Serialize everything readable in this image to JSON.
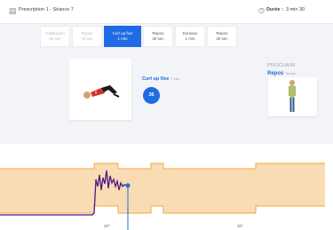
{
  "header": {
    "title": "Prescription 1 - Séance 7",
    "duration_label": "Durée :",
    "duration_value": "3 min 30"
  },
  "steps": [
    {
      "label": "Calibration",
      "value": "30 sec",
      "state": "done"
    },
    {
      "label": "Repos",
      "value": "15 sec",
      "state": "done"
    },
    {
      "label": "Curl up fixe",
      "value": "1 min",
      "state": "active"
    },
    {
      "label": "Repos",
      "value": "30 sec",
      "state": "upcoming"
    },
    {
      "label": "Dorsaux",
      "value": "1 min",
      "state": "upcoming"
    },
    {
      "label": "Repos",
      "value": "30 sec",
      "state": "upcoming"
    }
  ],
  "exercise": {
    "name": "Curl up fixe",
    "duration": "1 min",
    "counter": "36"
  },
  "next": {
    "label": "PROCHAIN",
    "name": "Repos",
    "duration": "30 sec"
  },
  "chart_data": {
    "type": "line",
    "x_ticks": [
      "30\"",
      "30\""
    ],
    "target_band": {
      "low": 0.3,
      "high": 0.7
    },
    "series": [
      {
        "color": "#4b1a86",
        "values": [
          0.26,
          0.27,
          0.26,
          0.27,
          0.26,
          0.27,
          0.3,
          0.5,
          0.6,
          0.45,
          0.7,
          0.55,
          0.68,
          0.5,
          0.65,
          0.45,
          0.6,
          0.55,
          0.4,
          0.5
        ]
      }
    ],
    "cursor_value": 0.52,
    "colors": {
      "band": "#f8d3a0",
      "band_edge": "#f3a83a",
      "line": "#4b1a86",
      "cursor": "#1f6be3"
    }
  }
}
